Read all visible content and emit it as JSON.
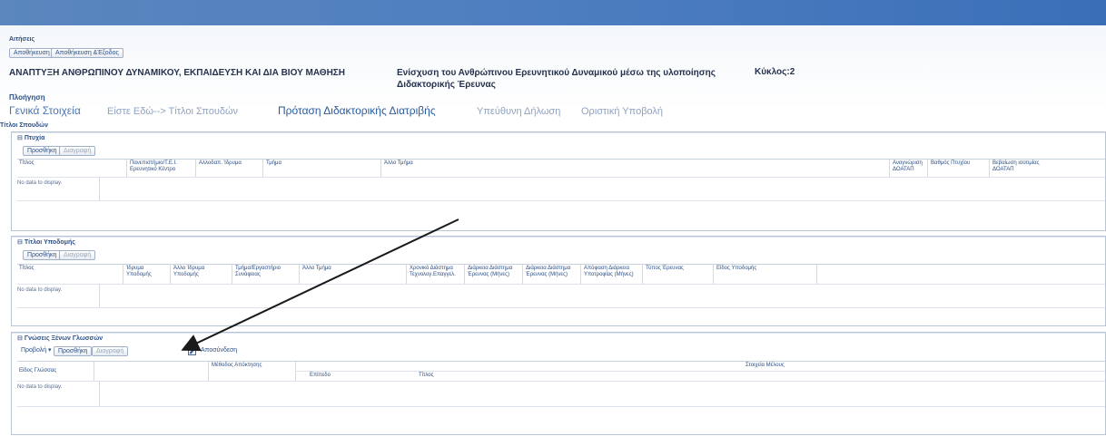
{
  "breadcrumb": "Αιτήσεις",
  "toolbar": {
    "save_label": "Αποθήκευση",
    "save_exit_label": "Αποθήκευση &Έξοδος"
  },
  "header": {
    "title_left": "ΑΝΑΠΤΥΞΗ ΑΝΘΡΩΠΙΝΟΥ ΔΥΝΑΜΙΚΟΥ, ΕΚΠΑΙΔΕΥΣΗ ΚΑΙ ΔΙΑ ΒΙΟΥ ΜΑΘΗΣΗ",
    "title_mid": "Ενίσχυση του Ανθρώπινου Ερευνητικού Δυναμικού μέσω της υλοποίησης Διδακτορικής Έρευνας",
    "cycle": "Κύκλος:2"
  },
  "navigation": {
    "label": "Πλοήγηση",
    "steps": [
      {
        "label": "Γενικά Στοιχεία"
      },
      {
        "label": "Είστε Εδώ--> Τίτλοι Σπουδών"
      },
      {
        "label": "Πρόταση Διδακτορικής Διατριβής"
      },
      {
        "label": "Υπεύθυνη Δήλωση"
      },
      {
        "label": "Οριστική Υποβολή"
      }
    ]
  },
  "section_title": "Τίτλοι Σπουδών",
  "panels": {
    "degrees": {
      "title": "Πτυχία",
      "add_label": "Προσθήκη",
      "delete_label": "Διαγραφή",
      "columns": [
        "Τίτλος",
        "Πανεπιστήμιο/Τ.Ε.Ι. Ερευνητικό Κέντρο",
        "Αλλοδαπ. Ίδρυμα",
        "Τμήμα",
        "Άλλο Τμήμα",
        "Αναγνώριση ΔΟΑΤΑΠ",
        "Βαθμός Πτυχίου",
        "Βεβαίωση ισοτιμίας ΔΟΑΤΑΠ"
      ],
      "empty_text": "No data to display."
    },
    "postgrad": {
      "title": "Τίτλοι Υποδομής",
      "add_label": "Προσθήκη",
      "delete_label": "Διαγραφή",
      "columns": [
        "Τίτλος",
        "Ίδρυμα Υποδομής",
        "Άλλο Ίδρυμα Υποδομής",
        "Τμήμα/Εργαστήριο Συνάφειας",
        "Άλλο Τμήμα",
        "Χρονικό Διάστημα Τεχνολογ.Επαγγελ.",
        "Διάρκεια Διάστημα Έρευνας (Μήνες)",
        "Διάρκεια Διάστημα Έρευνας (Μήνες)",
        "Απόφαση Διάρκεια Υποτροφίας (Μήνες)",
        "Τύπος Έρευνας",
        "Είδος Υποδομής"
      ],
      "empty_text": "No data to display."
    },
    "languages": {
      "title": "Γνώσεις Ξένων Γλωσσών",
      "view_label": "Προβολή",
      "add_label": "Προσθήκη",
      "delete_label": "Διαγραφή",
      "edit_label": "Αποσύνδεση",
      "columns": [
        "Είδος Γλώσσας",
        "",
        "Μέθοδος Απόκτησης",
        "Επίπεδο",
        "Τίτλος",
        "Στοιχεία Μέλους"
      ],
      "empty_text": "No data to display."
    }
  },
  "colors": {
    "topbar": "#4f7fc0",
    "nav_current": "#2b5a9c",
    "nav_future": "#8fa3c2",
    "arrow": "#1a1a1a"
  }
}
